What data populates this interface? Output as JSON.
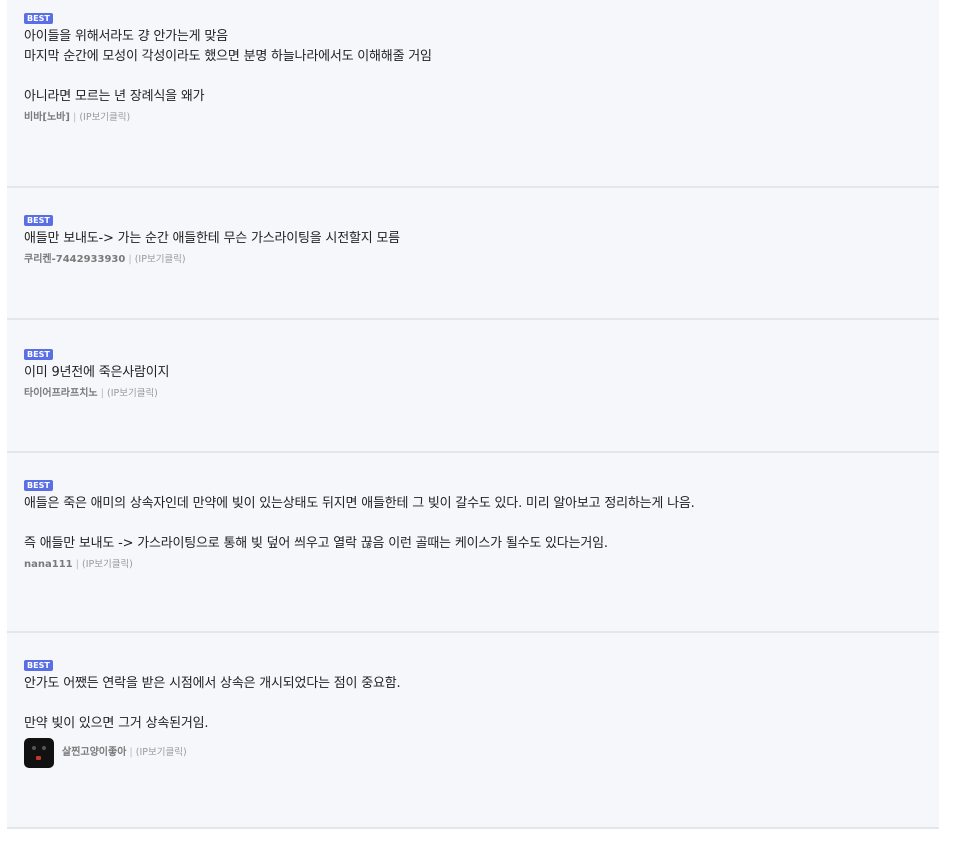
{
  "comments": [
    {
      "badge": "BEST",
      "text": "아이들을 위해서라도 걍 안가는게 맞음\n마지막 순간에 모성이 각성이라도 했으면 분명 하늘나라에서도 이해해줄 거임\n\n아니라면 모르는 년 장례식을 왜가",
      "author": "비바[노바]",
      "separator": "|",
      "ip": "(IP보기클릭)"
    },
    {
      "badge": "BEST",
      "text": "애들만 보내도-> 가는 순간 애들한테 무슨 가스라이팅을 시전할지 모름",
      "author": "쿠리켄-7442933930",
      "separator": "|",
      "ip": "(IP보기클릭)"
    },
    {
      "badge": "BEST",
      "text": "이미 9년전에 죽은사람이지",
      "author": "타이어프라프치노",
      "separator": "|",
      "ip": "(IP보기클릭)"
    },
    {
      "badge": "BEST",
      "text": "애들은 죽은 애미의 상속자인데 만약에 빚이 있는상태도 뒤지면 애들한테 그 빚이 갈수도 있다. 미리 알아보고 정리하는게 나음.\n\n즉 애들만 보내도 -> 가스라이팅으로 통해 빚 덮어 씌우고 열락 끊음 이런 골때는 케이스가 될수도 있다는거임.",
      "author": "nana111",
      "separator": "|",
      "ip": "(IP보기클릭)"
    },
    {
      "badge": "BEST",
      "text": "안가도 어쨌든 연락을 받은 시점에서 상속은 개시되었다는 점이 중요함.\n\n만약 빚이 있으면 그거 상속된거임.",
      "author": "살찐고양이좋아",
      "separator": "|",
      "ip": "(IP보기클릭)"
    }
  ]
}
